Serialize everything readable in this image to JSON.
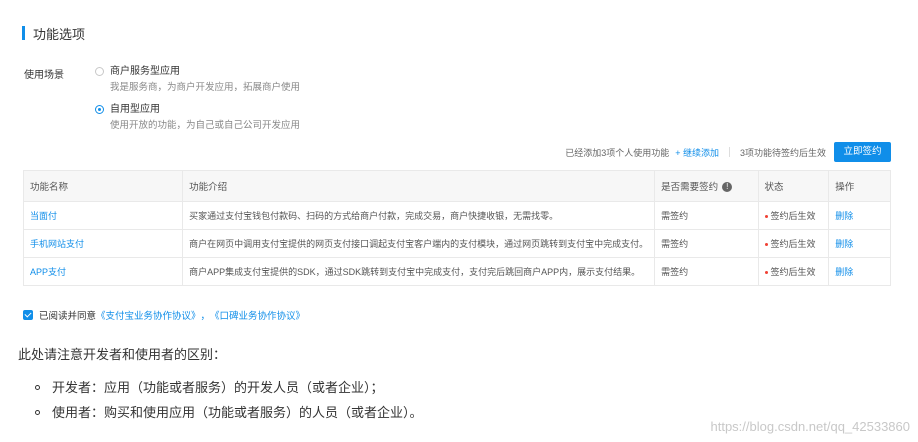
{
  "section": {
    "title": "功能选项"
  },
  "scene": {
    "label": "使用场景",
    "options": [
      {
        "title": "商户服务型应用",
        "desc": "我是服务商，为商户开发应用，拓展商户使用",
        "checked": false
      },
      {
        "title": "自用型应用",
        "desc": "使用开放的功能，为自己或自己公司开发应用",
        "checked": true
      }
    ]
  },
  "info": {
    "added_text": "已经添加3项个人使用功能",
    "add_link": "+ 继续添加",
    "pending_text": "3项功能待签约后生效",
    "sign_button": "立即签约"
  },
  "table": {
    "headers": [
      "功能名称",
      "功能介绍",
      "是否需要签约",
      "状态",
      "操作"
    ],
    "rows": [
      {
        "name": "当面付",
        "desc": "买家通过支付宝钱包付款码、扫码的方式给商户付款，完成交易，商户快捷收银，无需找零。",
        "sign": "需签约",
        "status": "签约后生效",
        "op": "删除"
      },
      {
        "name": "手机网站支付",
        "desc": "商户在网页中调用支付宝提供的网页支付接口调起支付宝客户端内的支付模块，通过网页跳转到支付宝中完成支付。",
        "sign": "需签约",
        "status": "签约后生效",
        "op": "删除"
      },
      {
        "name": "APP支付",
        "desc": "商户APP集成支付宝提供的SDK，通过SDK跳转到支付宝中完成支付，支付完后跳回商户APP内，展示支付结果。",
        "sign": "需签约",
        "status": "签约后生效",
        "op": "删除"
      }
    ]
  },
  "agreement": {
    "prefix": "已阅读并同意",
    "link1": "《支付宝业务协作协议》",
    "comma": "，",
    "link2": "《口碑业务协作协议》"
  },
  "note": {
    "heading": "此处请注意开发者和使用者的区别：",
    "items": [
      "开发者：应用（功能或者服务）的开发人员（或者企业）；",
      "使用者：购买和使用应用（功能或者服务）的人员（或者企业）。"
    ]
  },
  "watermark": "https://blog.csdn.net/qq_42533860"
}
